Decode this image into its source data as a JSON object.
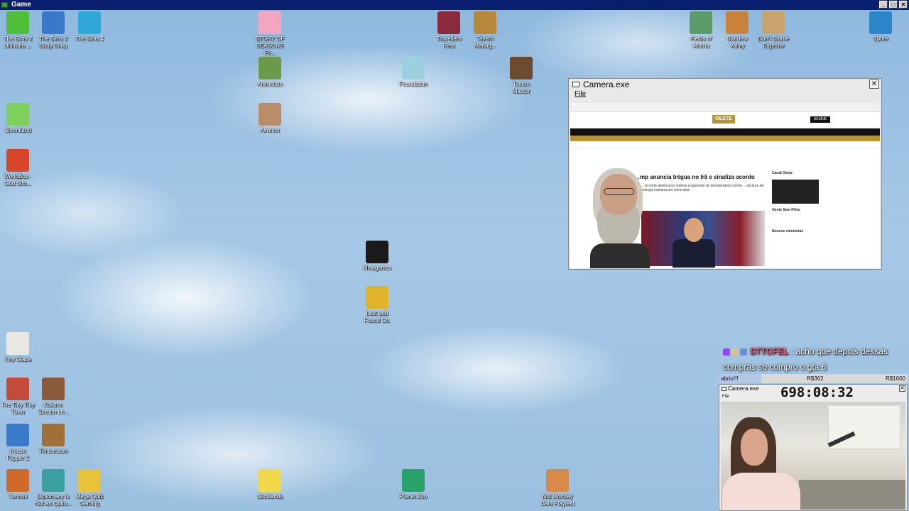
{
  "window": {
    "title": "Game"
  },
  "desktop_icons": [
    {
      "label": "The Sims 2\nUltimate ...",
      "icon": "sims-plumbob-icon",
      "color": "#4fbf3a"
    },
    {
      "label": "The Sims 2\nBody Shop",
      "icon": "sims-body-shop-icon",
      "color": "#3a78c9"
    },
    {
      "label": "The Sims 4",
      "icon": "sims4-icon",
      "color": "#2fa7d9"
    },
    {
      "label": "STORY OF\nSEASONS Fri...",
      "icon": "story-of-seasons-icon",
      "color": "#f3a6c0"
    },
    {
      "label": "Travellers\nRest",
      "icon": "travellers-rest-icon",
      "color": "#8a2a3a"
    },
    {
      "label": "Tavern\nManag...",
      "icon": "tavern-manager-icon",
      "color": "#b7873a"
    },
    {
      "label": "Fields of\nMistria",
      "icon": "fields-of-mistria-icon",
      "color": "#5c9c6b"
    },
    {
      "label": "Stardew\nValley",
      "icon": "stardew-valley-icon",
      "color": "#c9823a"
    },
    {
      "label": "Don't Starve\nTogether",
      "icon": "dont-starve-icon",
      "color": "#caa36a"
    },
    {
      "label": "Spore",
      "icon": "spore-icon",
      "color": "#2a86c9"
    },
    {
      "label": "Animelate",
      "icon": "animelate-icon",
      "color": "#6c9a4a"
    },
    {
      "label": "Foundation",
      "icon": "foundation-icon",
      "color": "#9ad0e0"
    },
    {
      "label": "Tavern\nMaster",
      "icon": "tavern-master-icon",
      "color": "#6e4a2e"
    },
    {
      "label": "Simmiland",
      "icon": "simmiland-icon",
      "color": "#7ed05a"
    },
    {
      "label": "Avorion",
      "icon": "avorion-icon",
      "color": "#b98c6a"
    },
    {
      "label": "WorldBox -\nGod Sim...",
      "icon": "worldbox-icon",
      "color": "#d8462a"
    },
    {
      "label": "Mewgenics",
      "icon": "mewgenics-icon",
      "color": "#1a1a1a"
    },
    {
      "label": "Lost and\nFound Co.",
      "icon": "lost-and-found-icon",
      "color": "#e0b32a"
    },
    {
      "label": "Tiny Glade",
      "icon": "tiny-glade-icon",
      "color": "#e8e8e0"
    },
    {
      "label": "The Tiny Tiny\nTown",
      "icon": "tiny-town-icon",
      "color": "#c44a3a"
    },
    {
      "label": "Kukoro:\nStream ch...",
      "icon": "kukoro-icon",
      "color": "#8a5a3a"
    },
    {
      "label": "House\nFlipper 2",
      "icon": "house-flipper-icon",
      "color": "#3a7ac9"
    },
    {
      "label": "Timberborn",
      "icon": "timberborn-icon",
      "color": "#a0703a"
    },
    {
      "label": "Turmoil",
      "icon": "turmoil-icon",
      "color": "#d06a2a"
    },
    {
      "label": "Diplomacy is\nNot an Optio...",
      "icon": "diplomacy-icon",
      "color": "#3aa0a0"
    },
    {
      "label": "Mega Quiz\nGaming",
      "icon": "mega-quiz-icon",
      "color": "#e8c23a"
    },
    {
      "label": "Sticklands",
      "icon": "sticklands-icon",
      "color": "#f0d84a"
    },
    {
      "label": "Planet Zoo",
      "icon": "planet-zoo-icon",
      "color": "#2aa06a"
    },
    {
      "label": "Not Monday\nCafé Playtest",
      "icon": "not-monday-cafe-icon",
      "color": "#d88a4a"
    }
  ],
  "camera_main": {
    "title": "Camera.exe",
    "menu_file": "File",
    "close": "✕",
    "site_logo": "OESTE",
    "subscribe": "ASSINE",
    "headline": "…mp anuncia trégua no Irã e sinaliza acordo",
    "deck": "…te norte-americano ordena suspensão de bombardeios contra …strutura de energia iraniana por cinco dias",
    "sidebar_title": "Canal Oeste",
    "sidebar_item": "Oeste Sem Filtro",
    "sidebar_section": "Nossos colunistas"
  },
  "chat": {
    "username": "STTOFEL",
    "message": ": acho que depois dessas compras so compro o gta 6"
  },
  "goal": {
    "left": "abriu!!!",
    "current": "R$362",
    "target": "R$1600",
    "progress": 0.2263
  },
  "camera_small": {
    "title": "Camera.exe",
    "menu_file": "File",
    "close": "✕",
    "timer": "698:08:32"
  }
}
